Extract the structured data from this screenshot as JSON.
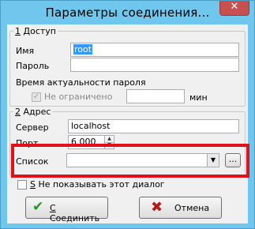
{
  "window": {
    "title": "Параметры соединения...",
    "close_symbol": "✕"
  },
  "access": {
    "legend": "1 Доступ",
    "name_label": "Имя",
    "name_value": "root",
    "password_label": "Пароль",
    "password_value": "",
    "relevance_label": "Время актуальности пароля",
    "unlimited_label": "Не ограничено",
    "unlimited_checked": true,
    "minutes_value": "",
    "minutes_label": "мин"
  },
  "address": {
    "legend": "2 Адрес",
    "server_label": "Сервер",
    "server_value": "localhost",
    "port_label": "Порт",
    "port_value": "6 000",
    "list_label": "Список",
    "list_value": "",
    "browse_label": "..."
  },
  "dont_show": {
    "label": "Не показывать этот диалог",
    "hotkey": "S",
    "checked": false
  },
  "buttons": {
    "connect_label": "Соединить",
    "connect_hotkey": "C",
    "cancel_label": "Отмена"
  },
  "colors": {
    "frame": "#6fc7ee",
    "close": "#c75050",
    "highlight": "#e3101a",
    "selection": "#3399ff"
  }
}
